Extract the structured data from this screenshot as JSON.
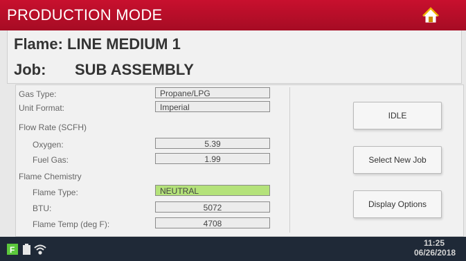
{
  "header": {
    "title": "PRODUCTION MODE",
    "home_icon": "home-icon"
  },
  "flame": {
    "label": "Flame:",
    "value": "LINE MEDIUM 1",
    "text": "Flame: LINE MEDIUM 1"
  },
  "job": {
    "label": "Job:",
    "value": "SUB ASSEMBLY"
  },
  "fields": {
    "gas_type": {
      "label": "Gas Type:",
      "value": "Propane/LPG"
    },
    "unit_format": {
      "label": "Unit Format:",
      "value": "Imperial"
    },
    "flow_rate_header": "Flow Rate (SCFH)",
    "oxygen": {
      "label": "Oxygen:",
      "value": "5.39"
    },
    "fuel_gas": {
      "label": "Fuel Gas:",
      "value": "1.99"
    },
    "flame_chemistry_header": "Flame Chemistry",
    "flame_type": {
      "label": "Flame Type:",
      "value": "NEUTRAL"
    },
    "btu": {
      "label": "BTU:",
      "value": "5072"
    },
    "flame_temp": {
      "label": "Flame Temp (deg F):",
      "value": "4708"
    }
  },
  "buttons": {
    "idle": "IDLE",
    "select_new_job": "Select New Job",
    "display_options": "Display Options"
  },
  "status": {
    "time": "11:25",
    "date": "06/26/2018",
    "icons": [
      "battery-icon",
      "wifi-icon"
    ],
    "brand_badge": "F"
  },
  "colors": {
    "header_red": "#c8102e",
    "status_bar": "#1f2937",
    "flame_type_highlight": "#b4e27a",
    "badge_green": "#5cc83c"
  }
}
